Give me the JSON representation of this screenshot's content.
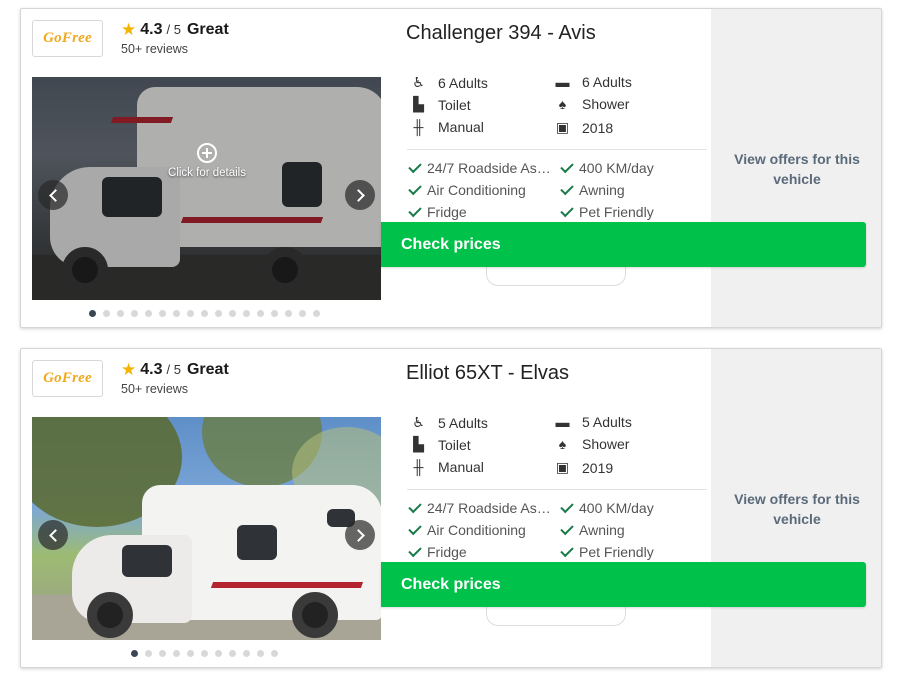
{
  "listings": [
    {
      "brand": "GoFree",
      "rating": {
        "score": "4.3",
        "out_of": "/ 5",
        "word": "Great",
        "reviews": "50+ reviews"
      },
      "image": {
        "zoom_text": "Click for details",
        "dot_count": 17,
        "active_dot": 0
      },
      "title": "Challenger 394 - Avis",
      "specs": {
        "seats": "6 Adults",
        "beds": "6 Adults",
        "toilet": "Toilet",
        "shower": "Shower",
        "transmission": "Manual",
        "year": "2018"
      },
      "features": [
        "24/7 Roadside As…",
        "400 KM/day",
        "Air Conditioning",
        "Awning",
        "Fridge",
        "Pet Friendly"
      ],
      "offers_label": "View offers for this vehicle",
      "cta": "Check prices"
    },
    {
      "brand": "GoFree",
      "rating": {
        "score": "4.3",
        "out_of": "/ 5",
        "word": "Great",
        "reviews": "50+ reviews"
      },
      "image": {
        "zoom_text": "",
        "dot_count": 11,
        "active_dot": 0
      },
      "title": "Elliot 65XT - Elvas",
      "specs": {
        "seats": "5 Adults",
        "beds": "5 Adults",
        "toilet": "Toilet",
        "shower": "Shower",
        "transmission": "Manual",
        "year": "2019"
      },
      "features": [
        "24/7 Roadside As…",
        "400 KM/day",
        "Air Conditioning",
        "Awning",
        "Fridge",
        "Pet Friendly"
      ],
      "offers_label": "View offers for this vehicle",
      "cta": "Check prices"
    }
  ],
  "colors": {
    "cta_green": "#00c14a",
    "star": "#f4b400",
    "brand_orange": "#f0a81c",
    "check": "#1a7a4a"
  },
  "icons": [
    "star-icon",
    "seat-icon",
    "bed-icon",
    "toilet-icon",
    "shower-icon",
    "gearbox-icon",
    "camper-icon",
    "check-icon",
    "zoom-icon",
    "chevron-left-icon",
    "chevron-right-icon"
  ]
}
